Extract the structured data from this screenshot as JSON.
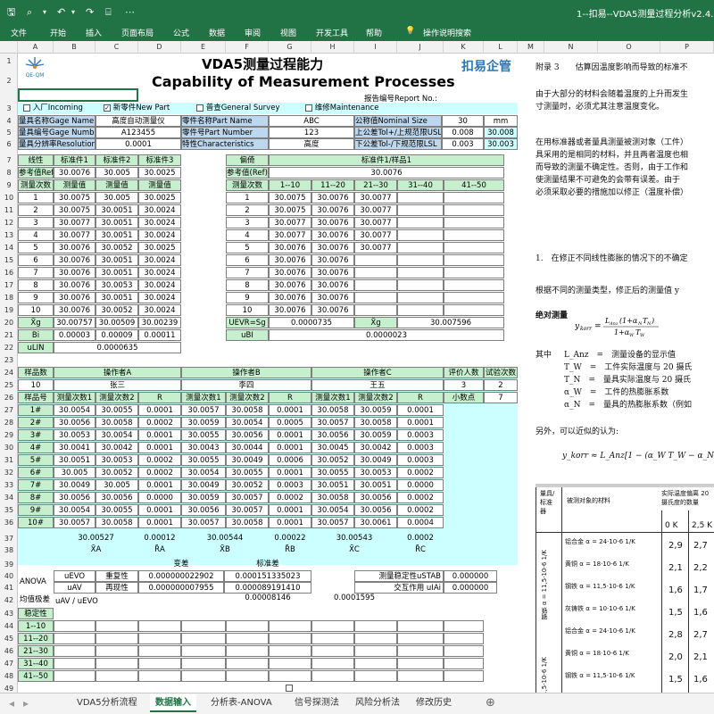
{
  "window": {
    "title": "1--扣易--VDA5测量过程分析v2.4.xl"
  },
  "ribbon": {
    "tabs": [
      "文件",
      "开始",
      "插入",
      "页面布局",
      "公式",
      "数据",
      "审阅",
      "视图",
      "开发工具",
      "帮助"
    ],
    "help_search": "操作说明搜索"
  },
  "columns": [
    "A",
    "B",
    "C",
    "D",
    "E",
    "F",
    "G",
    "H",
    "I",
    "J",
    "K",
    "L",
    "M",
    "N",
    "O",
    "P"
  ],
  "rows": [
    "1",
    "2",
    "3",
    "4",
    "5",
    "6",
    "7",
    "8",
    "9",
    "10",
    "11",
    "12",
    "13",
    "14",
    "15",
    "16",
    "17",
    "18",
    "19",
    "20",
    "21",
    "22",
    "23",
    "24",
    "25",
    "26",
    "27",
    "28",
    "29",
    "30",
    "31",
    "32",
    "33",
    "34",
    "35",
    "36",
    "37",
    "38",
    "39",
    "40",
    "41",
    "42",
    "43",
    "44",
    "45",
    "46",
    "47",
    "48",
    "49"
  ],
  "header": {
    "logo": "QE-QM",
    "title_cn": "VDA5测量过程能力",
    "title_en": "Capability of Measurement Processes",
    "brand": "扣易企管",
    "report_no": "报告编号Report No.:"
  },
  "checks": [
    {
      "label": "入厂Incoming",
      "checked": false
    },
    {
      "label": "新零件New Part",
      "checked": true
    },
    {
      "label": "普查General Survey",
      "checked": false
    },
    {
      "label": "维修Maintenance",
      "checked": false
    }
  ],
  "info": {
    "gage_name_label": "量具名称Gage Name",
    "gage_name": "高度自动测量仪",
    "gage_no_label": "量具编号Gage Number",
    "gage_no": "A123455",
    "res_label": "量具分辨率Resolution",
    "res": "0.0001",
    "part_name_label": "零件名称Part Name",
    "part_name": "ABC",
    "part_no_label": "零件号Part Number",
    "part_no": "123",
    "char_label": "特性Characteristics",
    "char": "高度",
    "nominal_label": "公称值Nominal Size",
    "nominal": "30",
    "unit": "mm",
    "usl_label": "上公差Tol+/上规范限USL",
    "usl_tol": "0.008",
    "usl": "30.008",
    "lsl_label": "下公差Tol-/下规范限LSL",
    "lsl_tol": "0.003",
    "lsl": "30.003"
  },
  "linearity": {
    "title": "线性",
    "std_headers": [
      "标准件1",
      "标准件2",
      "标准件3"
    ],
    "ref_label": "参考值Ref",
    "ref": [
      "30.0076",
      "30.005",
      "30.0025"
    ],
    "cnt_label": "测量次数",
    "val_label": "测量值",
    "rows": [
      [
        "1",
        "30.0075",
        "30.005",
        "30.0025"
      ],
      [
        "2",
        "30.0075",
        "30.0051",
        "30.0024"
      ],
      [
        "3",
        "30.0077",
        "30.0051",
        "30.0024"
      ],
      [
        "4",
        "30.0077",
        "30.0051",
        "30.0024"
      ],
      [
        "5",
        "30.0076",
        "30.0052",
        "30.0025"
      ],
      [
        "6",
        "30.0076",
        "30.0051",
        "30.0024"
      ],
      [
        "7",
        "30.0076",
        "30.0051",
        "30.0024"
      ],
      [
        "8",
        "30.0076",
        "30.0053",
        "30.0024"
      ],
      [
        "9",
        "30.0076",
        "30.0051",
        "30.0024"
      ],
      [
        "10",
        "30.0076",
        "30.0052",
        "30.0024"
      ]
    ],
    "xg_label": "X̄g",
    "xg": [
      "30.00757",
      "30.00509",
      "30.00239"
    ],
    "bi_label": "Bi",
    "bi": [
      "0.00003",
      "0.00009",
      "0.00011"
    ],
    "ulin_label": "uLIN",
    "ulin": "0.0000635"
  },
  "bias": {
    "title": "偏倚",
    "std": "标准件1/样品1",
    "ref_label": "参考值(Ref)/X",
    "ref": "30.0076",
    "cnt_label": "测量次数",
    "groups": [
      "1--10",
      "11--20",
      "21--30",
      "31--40",
      "41--50"
    ],
    "rows": [
      [
        "1",
        "30.0075",
        "30.0076",
        "30.0077"
      ],
      [
        "2",
        "30.0075",
        "30.0076",
        "30.0077"
      ],
      [
        "3",
        "30.0077",
        "30.0076",
        "30.0077"
      ],
      [
        "4",
        "30.0077",
        "30.0076",
        "30.0077"
      ],
      [
        "5",
        "30.0076",
        "30.0076",
        "30.0077"
      ],
      [
        "6",
        "30.0076",
        "30.0076",
        ""
      ],
      [
        "7",
        "30.0076",
        "30.0076",
        ""
      ],
      [
        "8",
        "30.0076",
        "30.0076",
        ""
      ],
      [
        "9",
        "30.0076",
        "30.0076",
        ""
      ],
      [
        "10",
        "30.0076",
        "30.0076",
        ""
      ]
    ],
    "uevr_label": "UEVR=Sg",
    "uevr": "0.0000735",
    "xg_label": "X̄g",
    "xg": "30.007596",
    "ubi_label": "uBI",
    "ubi": "0.0000023"
  },
  "grr": {
    "sample_cnt_label": "样品数",
    "sample_cnt": "10",
    "opA_label": "操作者A",
    "opA": "张三",
    "opB_label": "操作者B",
    "opB": "李四",
    "opC_label": "操作者C",
    "opC": "王五",
    "eval_label": "评价人数",
    "eval": "3",
    "trials_label": "试验次数",
    "trials": "2",
    "dec_label": "小数点",
    "dec": "7",
    "part_label": "样品号",
    "m1": "测量次数1",
    "m2": "测量次数2",
    "r": "R",
    "rows": [
      [
        "1#",
        "30.0054",
        "30.0055",
        "0.0001",
        "30.0057",
        "30.0058",
        "0.0001",
        "30.0058",
        "30.0059",
        "0.0001"
      ],
      [
        "2#",
        "30.0056",
        "30.0058",
        "0.0002",
        "30.0059",
        "30.0054",
        "0.0005",
        "30.0057",
        "30.0058",
        "0.0001"
      ],
      [
        "3#",
        "30.0053",
        "30.0054",
        "0.0001",
        "30.0055",
        "30.0056",
        "0.0001",
        "30.0056",
        "30.0059",
        "0.0003"
      ],
      [
        "4#",
        "30.0041",
        "30.0042",
        "0.0001",
        "30.0043",
        "30.0044",
        "0.0001",
        "30.0045",
        "30.0042",
        "0.0003"
      ],
      [
        "5#",
        "30.0051",
        "30.0053",
        "0.0002",
        "30.0055",
        "30.0049",
        "0.0006",
        "30.0052",
        "30.0049",
        "0.0003"
      ],
      [
        "6#",
        "30.005",
        "30.0052",
        "0.0002",
        "30.0054",
        "30.0055",
        "0.0001",
        "30.0055",
        "30.0053",
        "0.0002"
      ],
      [
        "7#",
        "30.0049",
        "30.005",
        "0.0001",
        "30.0049",
        "30.0052",
        "0.0003",
        "30.0051",
        "30.0051",
        "0.0000"
      ],
      [
        "8#",
        "30.0056",
        "30.0056",
        "0.0000",
        "30.0059",
        "30.0057",
        "0.0002",
        "30.0058",
        "30.0056",
        "0.0002"
      ],
      [
        "9#",
        "30.0054",
        "30.0055",
        "0.0001",
        "30.0056",
        "30.0057",
        "0.0001",
        "30.0054",
        "30.0056",
        "0.0002"
      ],
      [
        "10#",
        "30.0057",
        "30.0058",
        "0.0001",
        "30.0057",
        "30.0058",
        "0.0001",
        "30.0057",
        "30.0061",
        "0.0004"
      ]
    ],
    "xa": "30.00527",
    "ra": "0.00012",
    "xb": "30.00544",
    "rb": "0.00022",
    "xc": "30.00543",
    "rc": "0.0002",
    "xa_label": "X̄A",
    "ra_label": "R̄A",
    "xb_label": "X̄B",
    "rb_label": "R̄B",
    "xc_label": "X̄C",
    "rc_label": "R̄C"
  },
  "anova": {
    "label": "ANOVA",
    "var_label": "变差",
    "std_label": "标准差",
    "uevo_label": "uEVO",
    "rep_label": "重复性",
    "rep_var": "0.000000022902",
    "rep_std": "0.000151335023",
    "uav_label": "uAV",
    "repro_label": "再现性",
    "repro_var": "0.000000007955",
    "repro_std": "0.000089191410",
    "stab_label": "测量稳定性uSTAB",
    "stab": "0.000000",
    "inter_label": "交互作用 uIAi",
    "inter": "0.000000",
    "max_label": "均值极差",
    "uav_uevo_label": "uAV / uEVO",
    "v1": "0.00008146",
    "v2": "0.0001595"
  },
  "stability": {
    "label": "稳定性",
    "rows": [
      "1--10",
      "11--20",
      "21--30",
      "31--40",
      "41--50"
    ]
  },
  "sheets": [
    "VDA5分析流程",
    "数据输入",
    "分析表-ANOVA",
    "信号探测法",
    "风险分析法",
    "修改历史"
  ],
  "active_sheet": "数据输入",
  "doc": {
    "line1": "附录 3　　估算因温度影响而导致的标准不",
    "p1a": "由于大部分的材料会随着温度的上升而发生",
    "p1b": "寸测量时，必须尤其注意温度变化。",
    "p2a": "在用标准器或者量具测量被测对象（工件）",
    "p2b": "具采用的是相同的材料，并且两者温度也相",
    "p2c": "而导致的测量不确定性。否则，由于工作和",
    "p2d": "使测量结果不可避免的会带有误差。由于",
    "p2e": "必须采取必要的措施加以修正（温度补偿）",
    "sec1": "1.　在修正不同线性膨胀的情况下的不确定",
    "p3": "根据不同的测量类型，修正后的测量值 y",
    "abs": "绝对测量",
    "formula": "y_korr = L_Anz(1+α_N T_N) / (1+α_W T_W)",
    "where": "其中",
    "defs": [
      "L_Anz　=　测量设备的显示值",
      "T_W　=　工件实际温度与 20 摄氏",
      "T_N　=　量具实际温度与 20 摄氏",
      "α_W　=　工件的热膨胀系数",
      "α_N　=　量具的热膨胀系数（例如"
    ],
    "approx": "另外，可以近似的认为:",
    "formula2": "y_korr ≈ L_Anz[1 − (α_W T_W − α_N T_N)]",
    "tbl_h1": "量具/标准器",
    "tbl_h2": "被测对象的材料",
    "tbl_h3": "实际温度偏离 20 摄氏度的数量",
    "tbl_cols": [
      "0 K",
      "2,5 K"
    ],
    "tbl_rows": [
      [
        "铝合金 α = 24·10-6 1/K",
        "2,9",
        "2,7"
      ],
      [
        "黄铜 α = 18·10-6 1/K",
        "2,1",
        "2,2"
      ],
      [
        "钢铁 α = 11,5·10-6 1/K",
        "1,6",
        "1,7"
      ],
      [
        "灰铸铁 α = 10·10-6 1/K",
        "1,5",
        "1,6"
      ],
      [
        "铝合金 α = 24·10-6 1/K",
        "2,8",
        "2,7"
      ],
      [
        "黄铜 α = 18·10-6 1/K",
        "2,0",
        "2,1"
      ],
      [
        "钢铁 α = 11,5·10-6 1/K",
        "1,5",
        "1,6"
      ]
    ],
    "tbl_side": [
      "钢铁 α = 11,5·10-6 1/K",
      "钢铁 α = 11,5·10-6 1/K"
    ]
  }
}
